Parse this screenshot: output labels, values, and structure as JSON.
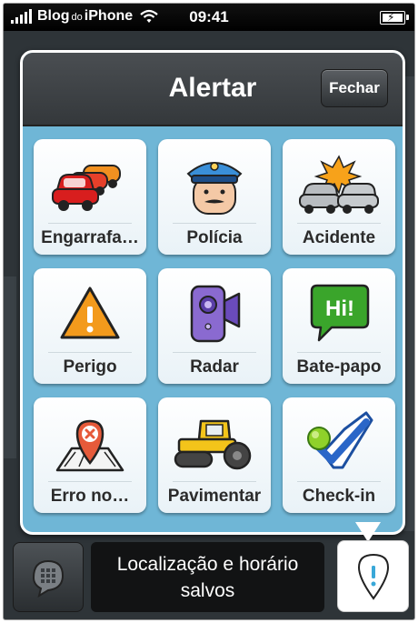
{
  "status_bar": {
    "carrier_pre": "Blog",
    "carrier_mid": "do",
    "carrier_post": "iPhone",
    "time": "09:41"
  },
  "modal": {
    "title": "Alertar",
    "close_label": "Fechar",
    "items": [
      {
        "label": "Engarrafa…",
        "icon": "traffic-jam-icon"
      },
      {
        "label": "Polícia",
        "icon": "police-icon"
      },
      {
        "label": "Acidente",
        "icon": "accident-icon"
      },
      {
        "label": "Perigo",
        "icon": "hazard-icon"
      },
      {
        "label": "Radar",
        "icon": "speed-camera-icon"
      },
      {
        "label": "Bate-papo",
        "icon": "chat-bubble-icon"
      },
      {
        "label": "Erro no…",
        "icon": "map-error-icon"
      },
      {
        "label": "Pavimentar",
        "icon": "road-roller-icon"
      },
      {
        "label": "Check-in",
        "icon": "check-in-icon"
      }
    ]
  },
  "toast": {
    "line1": "Localização e horário",
    "line2": "salvos"
  },
  "colors": {
    "modal_background": "#6fb6d6",
    "header": "#3d4145",
    "hazard_orange": "#f39a1c",
    "chat_green": "#3aa52b"
  }
}
